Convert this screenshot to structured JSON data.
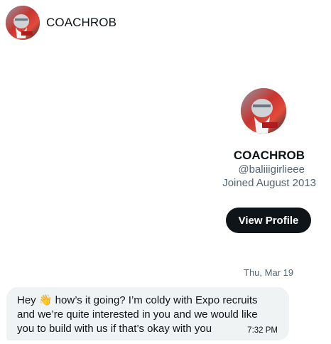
{
  "conversation": {
    "header_name": "COACHROB"
  },
  "profile": {
    "display_name": "COACHROB",
    "handle": "@baliiigirlieee",
    "joined": "Joined August 2013",
    "view_profile_label": "View Profile"
  },
  "messages": {
    "date_separator": "Thu, Mar 19",
    "items": [
      {
        "text": "Hey 👋 how’s it going? I’m coldy with Expo recruits and we’re quite interested in you and we would like you to build with us if that’s okay with you",
        "time": "7:32 PM"
      }
    ]
  },
  "colors": {
    "primary_text": "#0f1419",
    "secondary_text": "#536471",
    "bubble_bg": "#eff3f4",
    "button_bg": "#0f1419"
  }
}
